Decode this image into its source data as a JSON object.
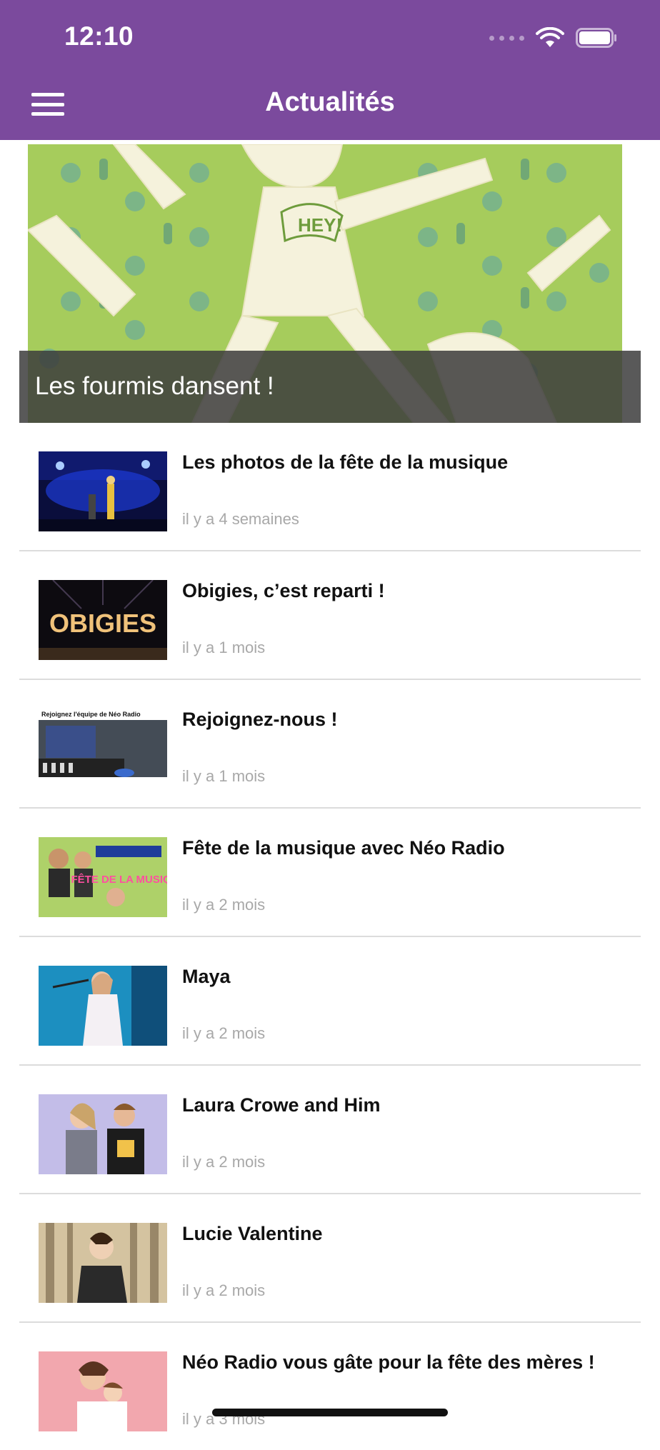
{
  "status_bar": {
    "time": "12:10"
  },
  "header": {
    "title": "Actualités",
    "menu_icon": "hamburger-menu-icon"
  },
  "featured": {
    "title": "Les fourmis dansent !",
    "badge": "HEY!"
  },
  "articles": [
    {
      "title": "Les photos de la fête de la musique",
      "time": "il y a 4 semaines"
    },
    {
      "title": "Obigies, c’est reparti !",
      "time": "il y a 1 mois",
      "thumb_text": "OBIGIES"
    },
    {
      "title": "Rejoignez-nous !",
      "time": "il y a 1 mois",
      "thumb_text": "Rejoignez l'équipe de Néo Radio"
    },
    {
      "title": "Fête de la musique avec Néo Radio",
      "time": "il y a 2 mois",
      "thumb_text": "FÊTE DE LA MUSIQUE"
    },
    {
      "title": "Maya",
      "time": "il y a 2 mois"
    },
    {
      "title": "Laura Crowe and Him",
      "time": "il y a 2 mois"
    },
    {
      "title": "Lucie Valentine",
      "time": "il y a 2 mois"
    },
    {
      "title": "Néo Radio vous gâte pour la fête des mères !",
      "time": "il y a 3 mois"
    }
  ],
  "colors": {
    "header": "#7b4a9d",
    "hero_green": "#a6cc5c"
  }
}
